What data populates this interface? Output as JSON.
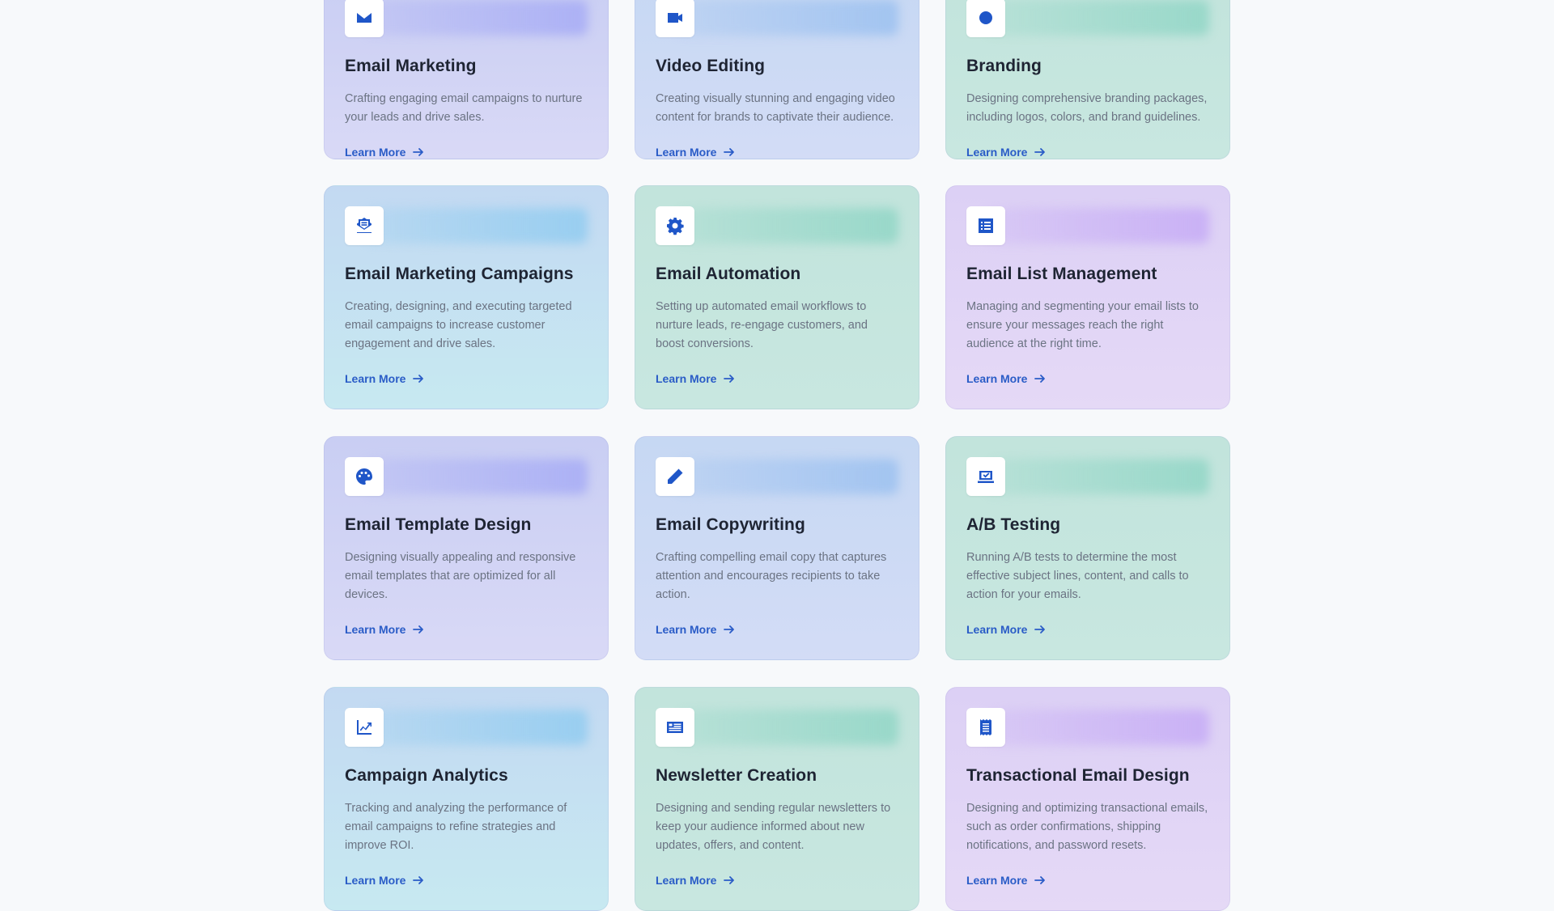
{
  "learn_more": "Learn More",
  "colors": {
    "accent": "#2a5cc7",
    "icon": "#1f56c8",
    "title": "#1e2433",
    "text": "#6b7383",
    "page_bg": "#f7f9fb"
  },
  "cards": [
    {
      "title": "Email Marketing",
      "description": "Crafting engaging email campaigns to nurture your leads and drive sales.",
      "icon": "envelope-icon"
    },
    {
      "title": "Video Editing",
      "description": "Creating visually stunning and engaging video content for brands to captivate their audience.",
      "icon": "video-icon"
    },
    {
      "title": "Branding",
      "description": "Designing comprehensive branding packages, including logos, colors, and brand guidelines.",
      "icon": "brand-icon"
    },
    {
      "title": "Email Marketing Campaigns",
      "description": "Creating, designing, and executing targeted email campaigns to increase customer engagement and drive sales.",
      "icon": "envelope-open-text-icon"
    },
    {
      "title": "Email Automation",
      "description": "Setting up automated email workflows to nurture leads, re-engage customers, and boost conversions.",
      "icon": "gear-icon"
    },
    {
      "title": "Email List Management",
      "description": "Managing and segmenting your email lists to ensure your messages reach the right audience at the right time.",
      "icon": "list-icon"
    },
    {
      "title": "Email Template Design",
      "description": "Designing visually appealing and responsive email templates that are optimized for all devices.",
      "icon": "palette-icon"
    },
    {
      "title": "Email Copywriting",
      "description": "Crafting compelling email copy that captures attention and encourages recipients to take action.",
      "icon": "pencil-icon"
    },
    {
      "title": "A/B Testing",
      "description": "Running A/B tests to determine the most effective subject lines, content, and calls to action for your emails.",
      "icon": "laptop-check-icon"
    },
    {
      "title": "Campaign Analytics",
      "description": "Tracking and analyzing the performance of email campaigns to refine strategies and improve ROI.",
      "icon": "chart-line-icon"
    },
    {
      "title": "Newsletter Creation",
      "description": "Designing and sending regular newsletters to keep your audience informed about new updates, offers, and content.",
      "icon": "newspaper-icon"
    },
    {
      "title": "Transactional Email Design",
      "description": "Designing and optimizing transactional emails, such as order confirmations, shipping notifications, and password resets.",
      "icon": "receipt-icon"
    }
  ]
}
